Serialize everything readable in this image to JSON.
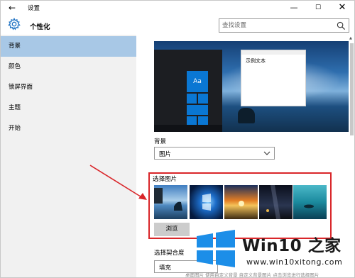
{
  "window": {
    "title": "设置",
    "back_icon": "back-arrow-icon",
    "minimize_glyph": "—",
    "maximize_glyph": "☐",
    "close_glyph": "✕"
  },
  "header": {
    "title": "个性化",
    "icon": "gear-icon"
  },
  "search": {
    "placeholder": "查找设置",
    "value": ""
  },
  "sidebar": {
    "items": [
      {
        "label": "背景",
        "active": true
      },
      {
        "label": "颜色",
        "active": false
      },
      {
        "label": "锁屏界面",
        "active": false
      },
      {
        "label": "主题",
        "active": false
      },
      {
        "label": "开始",
        "active": false
      }
    ]
  },
  "preview": {
    "tile_label": "Aa",
    "sample_text": "示例文本"
  },
  "background": {
    "label": "背景",
    "selected": "图片"
  },
  "choose_picture": {
    "label": "选择图片",
    "browse_label": "浏览"
  },
  "fit": {
    "label": "选择契合度",
    "selected": "填充"
  },
  "watermark": {
    "title": "Win10 之家",
    "url": "www.win10xitong.com",
    "faded_text": "桌面图片 使用自定义背景 自定义背景图片 点击浏览进行选择图片"
  },
  "colors": {
    "accent": "#0a77d3",
    "sidebar_active": "#a8c8e6",
    "highlight_border": "#d9262a",
    "sidebar_bg": "#f1f1f1"
  }
}
